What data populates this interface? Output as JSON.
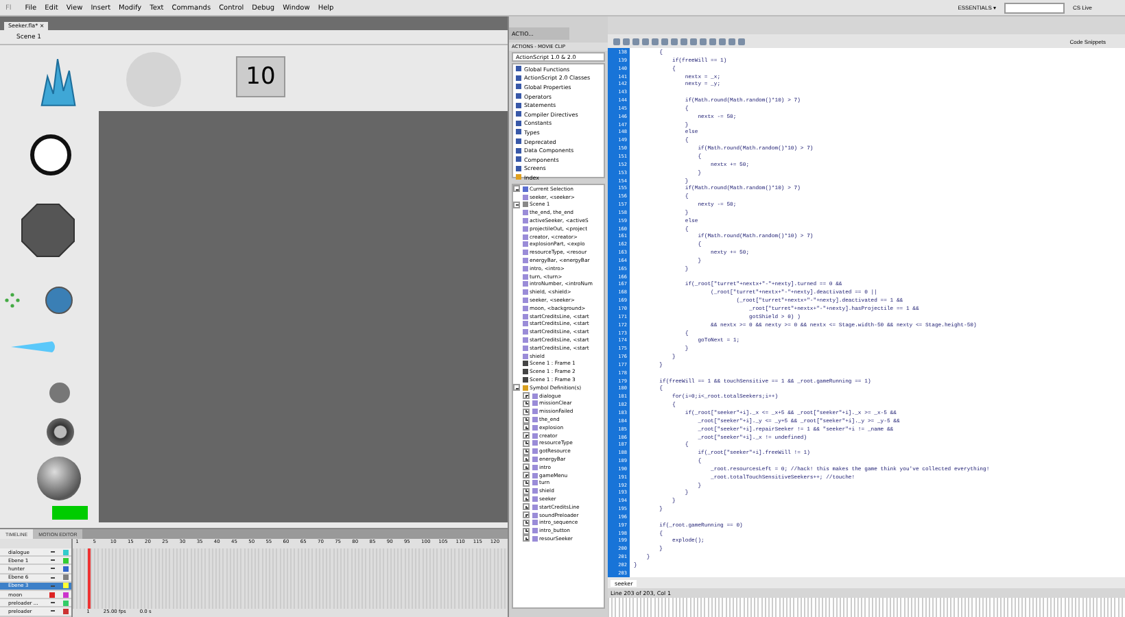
{
  "menu_bar": {
    "logo": "Fl",
    "items": [
      "File",
      "Edit",
      "View",
      "Insert",
      "Modify",
      "Text",
      "Commands",
      "Control",
      "Debug",
      "Window",
      "Help"
    ],
    "workspace": "ESSENTIALS ▾",
    "cs_live": "CS Live"
  },
  "document": {
    "tab": "Seeker.fla*",
    "close": "×",
    "breadcrumb": "Scene 1",
    "counter": "10"
  },
  "mini_panel": {
    "label": "ACTIO..."
  },
  "actions_panel": {
    "tab": "ACTIONS - MOVIE CLIP",
    "version": "ActionScript 1.0 & 2.0",
    "toolbox": [
      {
        "label": "Global Functions",
        "kind": "book"
      },
      {
        "label": "ActionScript 2.0 Classes",
        "kind": "book"
      },
      {
        "label": "Global Properties",
        "kind": "book"
      },
      {
        "label": "Operators",
        "kind": "book"
      },
      {
        "label": "Statements",
        "kind": "book"
      },
      {
        "label": "Compiler Directives",
        "kind": "book"
      },
      {
        "label": "Constants",
        "kind": "book"
      },
      {
        "label": "Types",
        "kind": "book"
      },
      {
        "label": "Deprecated",
        "kind": "book"
      },
      {
        "label": "Data Components",
        "kind": "book"
      },
      {
        "label": "Components",
        "kind": "book"
      },
      {
        "label": "Screens",
        "kind": "book"
      },
      {
        "label": "Index",
        "kind": "index"
      }
    ],
    "tree": [
      {
        "label": "Current Selection",
        "kind": "folder",
        "expanded": true,
        "children": [
          {
            "label": "seeker, <seeker>",
            "kind": "clip"
          }
        ]
      },
      {
        "label": "Scene 1",
        "kind": "scene",
        "expanded": true,
        "children": [
          {
            "label": "the_end, the_end",
            "kind": "clip"
          },
          {
            "label": "activeSeeker, <activeS",
            "kind": "clip"
          },
          {
            "label": "projectileOut, <project",
            "kind": "clip"
          },
          {
            "label": "creator, <creator>",
            "kind": "clip"
          },
          {
            "label": "explosionPart, <explo",
            "kind": "clip"
          },
          {
            "label": "resourceType, <resour",
            "kind": "clip"
          },
          {
            "label": "energyBar, <energyBar",
            "kind": "clip"
          },
          {
            "label": "intro, <intro>",
            "kind": "clip"
          },
          {
            "label": "turn, <turn>",
            "kind": "clip"
          },
          {
            "label": "introNumber, <introNum",
            "kind": "clip"
          },
          {
            "label": "shield, <shield>",
            "kind": "clip"
          },
          {
            "label": "seeker, <seeker>",
            "kind": "clip"
          },
          {
            "label": "moon, <background>",
            "kind": "clip"
          },
          {
            "label": "startCreditsLine, <start",
            "kind": "clip"
          },
          {
            "label": "startCreditsLine, <start",
            "kind": "clip"
          },
          {
            "label": "startCreditsLine, <start",
            "kind": "clip"
          },
          {
            "label": "startCreditsLine, <start",
            "kind": "clip"
          },
          {
            "label": "startCreditsLine, <start",
            "kind": "clip"
          },
          {
            "label": "shield",
            "kind": "clip"
          },
          {
            "label": "Scene 1 : Frame 1",
            "kind": "frame"
          },
          {
            "label": "Scene 1 : Frame 2",
            "kind": "frame"
          },
          {
            "label": "Scene 1 : Frame 3",
            "kind": "frame"
          }
        ]
      },
      {
        "label": "Symbol Definition(s)",
        "kind": "symbols",
        "expanded": true,
        "children": [
          {
            "label": "dialogue",
            "kind": "clip",
            "expanded": false
          },
          {
            "label": "missionClear",
            "kind": "clip",
            "expanded": false
          },
          {
            "label": "missionFailed",
            "kind": "clip",
            "expanded": false
          },
          {
            "label": "the_end",
            "kind": "clip",
            "expanded": false
          },
          {
            "label": "explosion",
            "kind": "clip",
            "expanded": false
          },
          {
            "label": "creator",
            "kind": "clip",
            "expanded": false
          },
          {
            "label": "resourceType",
            "kind": "clip",
            "expanded": false
          },
          {
            "label": "gotResource",
            "kind": "clip",
            "expanded": false
          },
          {
            "label": "energyBar",
            "kind": "clip",
            "expanded": false
          },
          {
            "label": "intro",
            "kind": "clip",
            "expanded": false
          },
          {
            "label": "gameMenu",
            "kind": "clip",
            "expanded": false
          },
          {
            "label": "turn",
            "kind": "clip",
            "expanded": false
          },
          {
            "label": "shield",
            "kind": "clip",
            "expanded": false
          },
          {
            "label": "seeker",
            "kind": "clip",
            "expanded": false
          },
          {
            "label": "startCreditsLine",
            "kind": "clip",
            "expanded": false
          },
          {
            "label": "soundPreloader",
            "kind": "clip",
            "expanded": false
          },
          {
            "label": "intro_sequence",
            "kind": "clip",
            "expanded": false
          },
          {
            "label": "intro_button",
            "kind": "clip",
            "expanded": false
          },
          {
            "label": "resourSeeker",
            "kind": "clip",
            "expanded": false
          }
        ]
      }
    ]
  },
  "code_editor": {
    "snippets": "Code Snippets",
    "file_tab": "seeker",
    "status": "Line 203 of 203, Col 1",
    "lines": [
      {
        "n": "138",
        "code": "        {"
      },
      {
        "n": "139",
        "code": "            if(freeWill == 1)"
      },
      {
        "n": "140",
        "code": "            {"
      },
      {
        "n": "141",
        "code": "                nextx = _x;"
      },
      {
        "n": "142",
        "code": "                nexty = _y;"
      },
      {
        "n": "143"
      },
      {
        "n": "144",
        "code": "                if(Math.round(Math.random()*10) > 7)"
      },
      {
        "n": "145",
        "code": "                {"
      },
      {
        "n": "146",
        "code": "                    nextx -= 50;"
      },
      {
        "n": "147",
        "code": "                }"
      },
      {
        "n": "148",
        "code": "                else"
      },
      {
        "n": "149",
        "code": "                {"
      },
      {
        "n": "150",
        "code": "                    if(Math.round(Math.random()*10) > 7)"
      },
      {
        "n": "151",
        "code": "                    {"
      },
      {
        "n": "152",
        "code": "                        nextx += 50;"
      },
      {
        "n": "153",
        "code": "                    }"
      },
      {
        "n": "154",
        "code": "                }"
      },
      {
        "n": "155",
        "code": "                if(Math.round(Math.random()*10) > 7)"
      },
      {
        "n": "156",
        "code": "                {"
      },
      {
        "n": "157",
        "code": "                    nexty -= 50;"
      },
      {
        "n": "158",
        "code": "                }"
      },
      {
        "n": "159",
        "code": "                else"
      },
      {
        "n": "160",
        "code": "                {"
      },
      {
        "n": "161",
        "code": "                    if(Math.round(Math.random()*10) > 7)"
      },
      {
        "n": "162",
        "code": "                    {"
      },
      {
        "n": "163",
        "code": "                        nexty += 50;"
      },
      {
        "n": "164",
        "code": "                    }"
      },
      {
        "n": "165",
        "code": "                }"
      },
      {
        "n": "166"
      },
      {
        "n": "167",
        "code": "                if(_root[\"turret\"+nextx+\"-\"+nexty].turned == 0 &&"
      },
      {
        "n": "168",
        "code": "                        (_root[\"turret\"+nextx+\"-\"+nexty].deactivated == 0 ||"
      },
      {
        "n": "169",
        "code": "                                (_root[\"turret\"+nextx+\"-\"+nexty].deactivated == 1 &&"
      },
      {
        "n": "170",
        "code": "                                    _root[\"turret\"+nextx+\"-\"+nexty].hasProjectile == 1 &&"
      },
      {
        "n": "171",
        "code": "                                    gotShield > 0) )"
      },
      {
        "n": "172",
        "code": "                        && nextx >= 0 && nexty >= 0 && nextx <= Stage.width-50 && nexty <= Stage.height-50)"
      },
      {
        "n": "173",
        "code": "                {"
      },
      {
        "n": "174",
        "code": "                    goToNext = 1;"
      },
      {
        "n": "175",
        "code": "                }"
      },
      {
        "n": "176",
        "code": "            }"
      },
      {
        "n": "177",
        "code": "        }"
      },
      {
        "n": "178"
      },
      {
        "n": "179",
        "code": "        if(freeWill == 1 && touchSensitive == 1 && _root.gameRunning == 1)"
      },
      {
        "n": "180",
        "code": "        {"
      },
      {
        "n": "181",
        "code": "            for(i=0;i<_root.totalSeekers;i++)"
      },
      {
        "n": "182",
        "code": "            {"
      },
      {
        "n": "183",
        "code": "                if(_root[\"seeker\"+i]._x <= _x+5 && _root[\"seeker\"+i]._x >= _x-5 &&"
      },
      {
        "n": "184",
        "code": "                    _root[\"seeker\"+i]._y <= _y+5 && _root[\"seeker\"+i]._y >= _y-5 &&"
      },
      {
        "n": "185",
        "code": "                    _root[\"seeker\"+i].repairSeeker != 1 && \"seeker\"+i != _name &&"
      },
      {
        "n": "186",
        "code": "                    _root[\"seeker\"+i]._x != undefined)"
      },
      {
        "n": "187",
        "code": "                {"
      },
      {
        "n": "188",
        "code": "                    if(_root[\"seeker\"+i].freeWill != 1)"
      },
      {
        "n": "189",
        "code": "                    {"
      },
      {
        "n": "190",
        "code": "                        _root.resourcesLeft = 0; //hack! this makes the game think you've collected everything!"
      },
      {
        "n": "191",
        "code": "                        _root.totalTouchSensitiveSeekers++; //touche!"
      },
      {
        "n": "192",
        "code": "                    }"
      },
      {
        "n": "193",
        "code": "                }"
      },
      {
        "n": "194",
        "code": "            }"
      },
      {
        "n": "195",
        "code": "        }"
      },
      {
        "n": "196"
      },
      {
        "n": "197",
        "code": "        if(_root.gameRunning == 0)"
      },
      {
        "n": "198",
        "code": "        {"
      },
      {
        "n": "199",
        "code": "            explode();"
      },
      {
        "n": "200",
        "code": "        }"
      },
      {
        "n": "201",
        "code": "    }"
      },
      {
        "n": "202",
        "code": "}"
      },
      {
        "n": "203"
      }
    ]
  },
  "timeline": {
    "tabs": [
      {
        "label": "TIMELINE",
        "selected": true
      },
      {
        "label": "MOTION EDITOR",
        "selected": false
      }
    ],
    "frame_numbers": [
      "1",
      "5",
      "10",
      "15",
      "20",
      "25",
      "30",
      "35",
      "40",
      "45",
      "50",
      "55",
      "60",
      "65",
      "70",
      "75",
      "80",
      "85",
      "90",
      "95",
      "100",
      "105",
      "110",
      "115",
      "120"
    ],
    "layers": [
      {
        "name": "dialogue",
        "selected": false,
        "hidden": false,
        "color": "#33cccc"
      },
      {
        "name": "Ebene 1",
        "selected": false,
        "hidden": false,
        "color": "#33cc33"
      },
      {
        "name": "hunter",
        "selected": false,
        "hidden": false,
        "color": "#3366cc"
      },
      {
        "name": "Ebene 6",
        "selected": false,
        "hidden": false,
        "color": "#808080"
      },
      {
        "name": "Ebene 3",
        "selected": true,
        "hidden": false,
        "color": "#ffff33"
      },
      {
        "name": "moon",
        "selected": false,
        "hidden": true,
        "color": "#cc33cc"
      },
      {
        "name": "preloader ...",
        "selected": false,
        "hidden": false,
        "color": "#33cc66"
      },
      {
        "name": "preloader",
        "selected": false,
        "hidden": false,
        "color": "#cc3333"
      }
    ],
    "current_frame": "1",
    "fps": "25.00 fps",
    "time": "0.0 s"
  }
}
